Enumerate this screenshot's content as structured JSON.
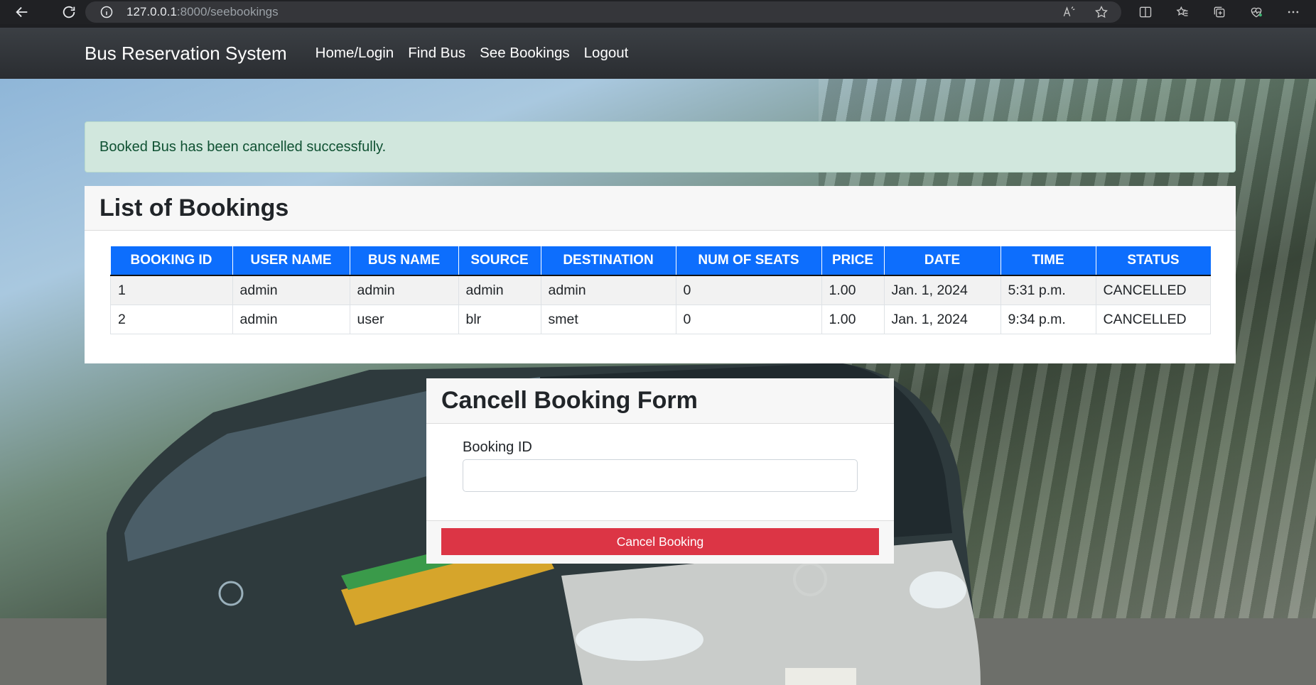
{
  "browser": {
    "url_host": "127.0.0.1",
    "url_path": ":8000/seebookings"
  },
  "navbar": {
    "brand": "Bus Reservation System",
    "links": [
      {
        "label": "Home/Login"
      },
      {
        "label": "Find Bus"
      },
      {
        "label": "See Bookings"
      },
      {
        "label": "Logout"
      }
    ]
  },
  "alert": {
    "message": "Booked Bus has been cancelled successfully."
  },
  "bookings": {
    "title": "List of Bookings",
    "columns": [
      "BOOKING ID",
      "USER NAME",
      "BUS NAME",
      "SOURCE",
      "DESTINATION",
      "NUM OF SEATS",
      "PRICE",
      "DATE",
      "TIME",
      "STATUS"
    ],
    "rows": [
      [
        "1",
        "admin",
        "admin",
        "admin",
        "admin",
        "0",
        "1.00",
        "Jan. 1, 2024",
        "5:31 p.m.",
        "CANCELLED"
      ],
      [
        "2",
        "admin",
        "user",
        "blr",
        "smet",
        "0",
        "1.00",
        "Jan. 1, 2024",
        "9:34 p.m.",
        "CANCELLED"
      ]
    ]
  },
  "cancel_form": {
    "title": "Cancell Booking Form",
    "booking_id_label": "Booking ID",
    "booking_id_value": "",
    "submit_label": "Cancel Booking"
  },
  "colors": {
    "primary": "#0d6efd",
    "danger": "#dc3545",
    "success_bg": "#d1e7dd",
    "success_text": "#0f5132",
    "navbar_bg": "#2a2d31"
  }
}
